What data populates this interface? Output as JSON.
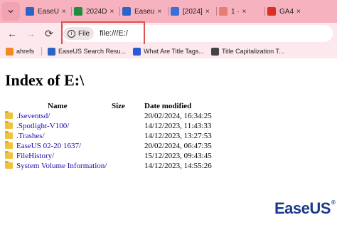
{
  "tabs": [
    {
      "label": "EaseU",
      "favicon": "easeus-favicon",
      "color": "#2b63c6"
    },
    {
      "label": "2024D",
      "favicon": "sheets-favicon",
      "color": "#1e8e3e"
    },
    {
      "label": "Easeu",
      "favicon": "easeus-favicon",
      "color": "#2b63c6"
    },
    {
      "label": "[2024]",
      "favicon": "link-favicon",
      "color": "#3b6fd8"
    },
    {
      "label": "1 ·",
      "favicon": "loading-favicon",
      "color": "#e67c73"
    },
    {
      "label": "GA4",
      "favicon": "analytics-favicon",
      "color": "#d93025"
    }
  ],
  "tab_close_glyph": "×",
  "toolbar": {
    "back_glyph": "←",
    "forward_glyph": "→",
    "reload_glyph": "⟳",
    "chip_label": "File",
    "url": "file:///E:/"
  },
  "bookmarks": [
    {
      "label": "ahrefs",
      "icon": "ahrefs-icon",
      "color": "#f08a24"
    },
    {
      "label": "EaseUS Search Resu...",
      "icon": "easeus-icon",
      "color": "#2b63c6"
    },
    {
      "label": "What Are Title Tags...",
      "icon": "m-icon",
      "color": "#2a5bd7"
    },
    {
      "label": "Title Capitalization T...",
      "icon": "gear-icon",
      "color": "#444444"
    }
  ],
  "page": {
    "title": "Index of E:\\",
    "headers": {
      "name": "Name",
      "size": "Size",
      "date": "Date modified"
    },
    "entries": [
      {
        "name": ".fseventsd/",
        "size": "",
        "date": "20/02/2024, 16:34:25"
      },
      {
        "name": ".Spotlight-V100/",
        "size": "",
        "date": "14/12/2023, 11:43:33"
      },
      {
        "name": ".Trashes/",
        "size": "",
        "date": "14/12/2023, 13:27:53"
      },
      {
        "name": "EaseUS 02-20 1637/",
        "size": "",
        "date": "20/02/2024, 06:47:35"
      },
      {
        "name": "FileHistory/",
        "size": "",
        "date": "15/12/2023, 09:43:45"
      },
      {
        "name": "System Volume Information/",
        "size": "",
        "date": "14/12/2023, 14:55:26"
      }
    ]
  },
  "watermark": {
    "text": "EaseUS",
    "mark": "®"
  },
  "colors": {
    "tabstrip": "#f6b3bf",
    "toolbar": "#fde9ed",
    "highlight": "#d9534f",
    "link": "#1a0dab"
  }
}
